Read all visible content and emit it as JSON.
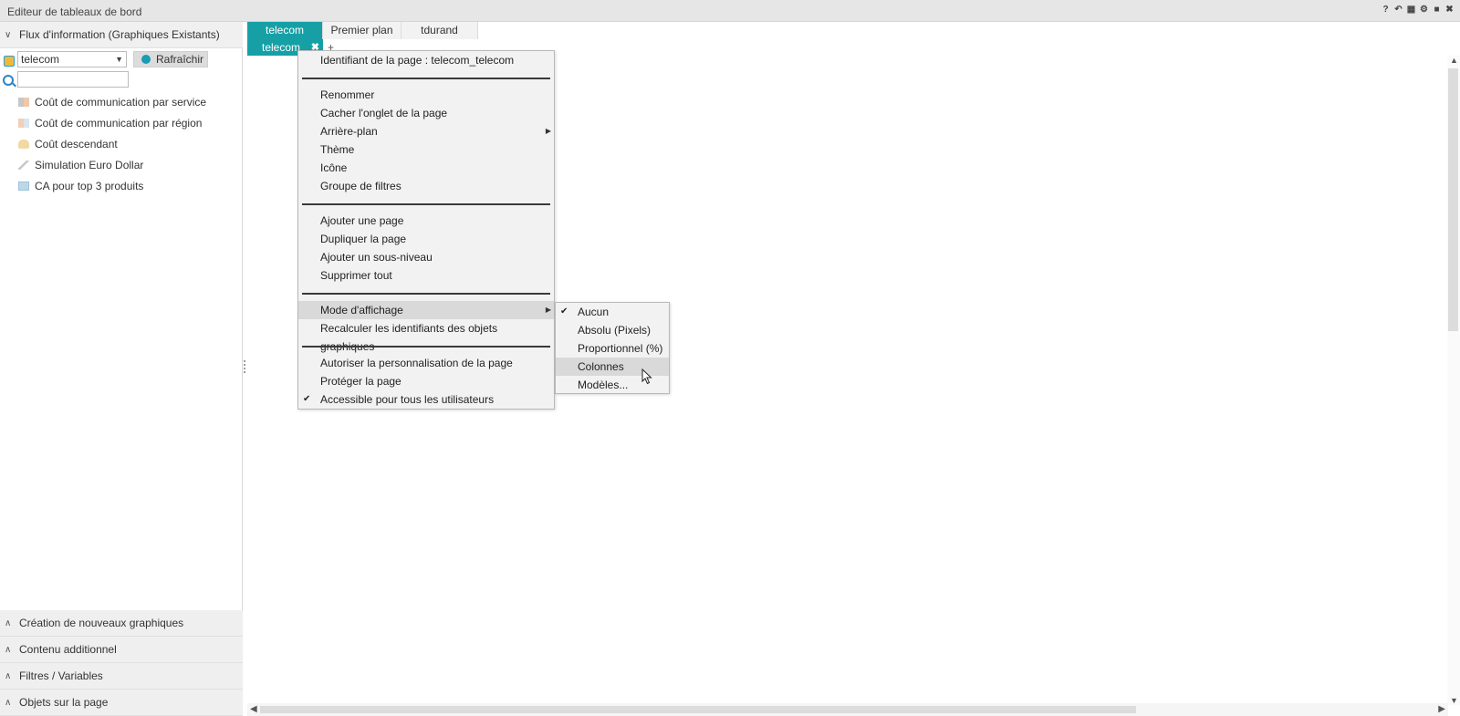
{
  "window": {
    "title": "Editeur de tableaux de bord"
  },
  "left_panel": {
    "flux_header": "Flux d'information (Graphiques Existants)",
    "source_select": {
      "value": "telecom"
    },
    "refresh_label": "Rafraîchir",
    "search": {
      "placeholder": ""
    },
    "items": [
      {
        "label": "Coût de communication par service",
        "icon": "chart-pie-icon"
      },
      {
        "label": "Coût de communication par région",
        "icon": "chart-map-icon"
      },
      {
        "label": "Coût descendant",
        "icon": "chart-area-icon"
      },
      {
        "label": "Simulation Euro Dollar",
        "icon": "chart-line-icon"
      },
      {
        "label": "CA pour top 3 produits",
        "icon": "chart-table-icon"
      }
    ],
    "sections": [
      "Création de nouveaux graphiques",
      "Contenu additionnel",
      "Filtres / Variables",
      "Objets sur la page"
    ]
  },
  "tabs": {
    "row1": [
      "telecom",
      "Premier plan",
      "tdurand"
    ],
    "row2_active": "telecom",
    "add_label": "+"
  },
  "context_menu": {
    "page_id": "Identifiant de la page : telecom_telecom",
    "group1": [
      "Renommer",
      "Cacher l'onglet de la page",
      "Arrière-plan",
      "Thème",
      "Icône",
      "Groupe de filtres"
    ],
    "group2": [
      "Ajouter une page",
      "Dupliquer la page",
      "Ajouter un sous-niveau",
      "Supprimer tout"
    ],
    "group3": [
      "Mode d'affichage",
      "Recalculer les identifiants des objets graphiques"
    ],
    "group4": [
      "Autoriser la personnalisation de la page",
      "Protéger la page",
      "Accessible pour tous les utilisateurs"
    ]
  },
  "display_mode_submenu": {
    "items": [
      "Aucun",
      "Absolu (Pixels)",
      "Proportionnel (%)",
      "Colonnes",
      "Modèles..."
    ],
    "checked": "Aucun",
    "highlighted": "Colonnes"
  },
  "colors": {
    "accent": "#16a0a6",
    "menu_bg": "#f2f2f2",
    "highlight": "#d9d9d9"
  }
}
